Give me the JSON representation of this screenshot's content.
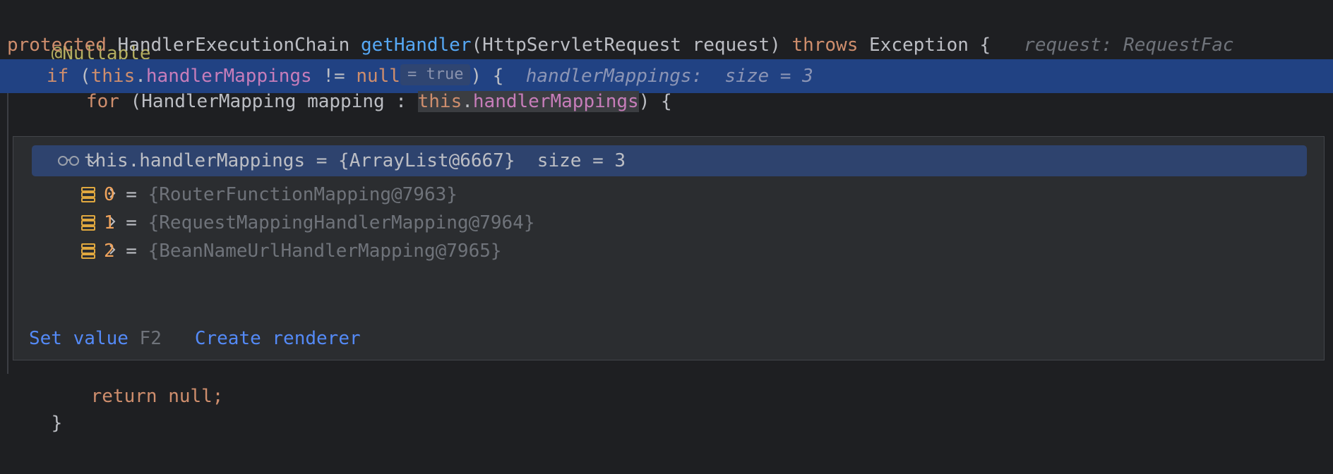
{
  "code": {
    "line1": {
      "annotation": "@Nullable"
    },
    "line2": {
      "kw_protected": "protected",
      "return_type": "HandlerExecutionChain",
      "method": "getHandler",
      "params": "(HttpServletRequest request)",
      "kw_throws": "throws",
      "exception": "Exception {",
      "hint": "request: RequestFac"
    },
    "line3": {
      "kw_if": "if",
      "open": "(",
      "kw_this": "this",
      "dot": ".",
      "field": "handlerMappings",
      "op": " != ",
      "kw_null": "null",
      "inline_value": "= true",
      "close": ") {",
      "hint": "handlerMappings:  size = 3"
    },
    "line4": {
      "kw_for": "for",
      "loop": "(HandlerMapping mapping : ",
      "kw_this": "this",
      "dot": ".",
      "field": "handlerMappings",
      "close": ") {"
    },
    "line_return": "return null;",
    "line_close": "}"
  },
  "popup": {
    "root": {
      "name": "this.handlerMappings",
      "value": " = {ArrayList@6667}",
      "size": "  size = 3"
    },
    "items": [
      {
        "index": "0",
        "eq": " = ",
        "value": "{RouterFunctionMapping@7963}"
      },
      {
        "index": "1",
        "eq": " = ",
        "value": "{RequestMappingHandlerMapping@7964}"
      },
      {
        "index": "2",
        "eq": " = ",
        "value": "{BeanNameUrlHandlerMapping@7965}"
      }
    ],
    "footer": {
      "set_value": "Set value",
      "set_value_key": "F2",
      "create_renderer": "Create renderer"
    }
  },
  "colors": {
    "background": "#1e1f22",
    "highlight": "#214283",
    "keyword": "#cf8e6d",
    "field": "#c77dba",
    "function": "#56a8f5",
    "annotation": "#b3ae60",
    "link": "#548af7"
  },
  "icons": {
    "expand": "chevron-down-icon",
    "collapsed": "chevron-right-icon",
    "watch": "glasses-icon",
    "element": "array-element-icon"
  }
}
